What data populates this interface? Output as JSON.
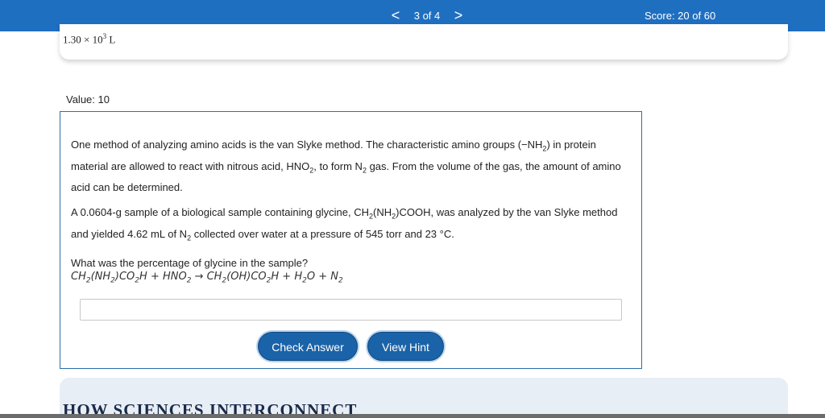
{
  "topbar": {
    "prev_glyph": "<",
    "next_glyph": ">",
    "page_indicator": "3 of 4",
    "score": "Score: 20 of 60"
  },
  "prev_card": {
    "answer_mantissa": "1.30 × 10",
    "answer_exponent": "3",
    "answer_unit": " L"
  },
  "question": {
    "value_label": "Value: 10",
    "p1": [
      "One method of analyzing amino acids is the van Slyke method. The characteristic amino groups (−NH",
      "2",
      ") in protein material are allowed to react with nitrous acid, HNO",
      "2",
      ", to form N",
      "2",
      " gas. From the volume of the gas, the amount of amino acid can be determined."
    ],
    "p2": [
      "A 0.0604-g sample of a biological sample containing glycine, CH",
      "2",
      "(NH",
      "2",
      ")COOH, was analyzed by the van Slyke method and yielded 4.62 mL of N",
      "2",
      " collected over water at a pressure of 545 torr and 23 °C."
    ],
    "p3": "What was the percentage of glycine in the sample?",
    "equation": [
      "CH",
      "2",
      "(NH",
      "2",
      ")CO",
      "2",
      "H + HNO",
      "2",
      " → CH",
      "2",
      "(OH)CO",
      "2",
      "H + H",
      "2",
      "O + N",
      "2"
    ],
    "answer_value": "",
    "answer_placeholder": ""
  },
  "buttons": {
    "check_answer": "Check Answer",
    "view_hint": "View Hint"
  },
  "next_card": {
    "heading": "HOW SCIENCES INTERCONNECT"
  },
  "colors": {
    "topbar": "#1f6fc1",
    "button": "#1b63a8",
    "question_border": "#2c6ea8"
  }
}
